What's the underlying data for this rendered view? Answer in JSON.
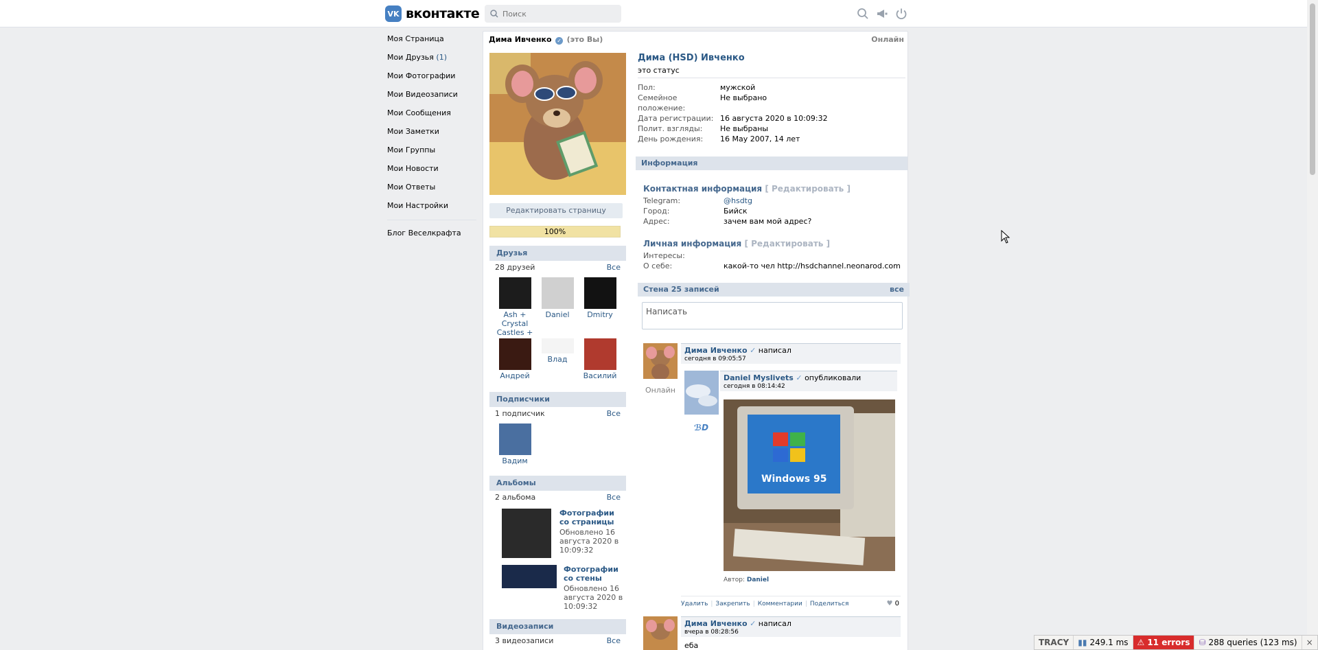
{
  "header": {
    "logo_mark": "VK",
    "logo_text": "вконтакте",
    "search_placeholder": "Поиск",
    "icons": [
      "search-icon",
      "megaphone-icon",
      "power-icon"
    ]
  },
  "leftnav": {
    "items": [
      {
        "label": "Моя Страница"
      },
      {
        "label": "Мои Друзья",
        "count": "(1)"
      },
      {
        "label": "Мои Фотографии"
      },
      {
        "label": "Мои Видеозаписи"
      },
      {
        "label": "Мои Сообщения"
      },
      {
        "label": "Мои Заметки"
      },
      {
        "label": "Мои Группы"
      },
      {
        "label": "Мои Новости"
      },
      {
        "label": "Мои Ответы"
      },
      {
        "label": "Мои Настройки"
      }
    ],
    "blog": "Блог Веселкрафта"
  },
  "page": {
    "name": "Дима Ивченко",
    "this_you": "(это Вы)",
    "online": "Онлайн",
    "edit_button": "Редактировать страницу",
    "progress": "100%",
    "progress_value": 100
  },
  "friends": {
    "title": "Друзья",
    "count": "28 друзей",
    "all": "Все",
    "items": [
      {
        "name": "Ash + Crystal Castles +"
      },
      {
        "name": "Daniel"
      },
      {
        "name": "Dmitry"
      },
      {
        "name": "Андрей"
      },
      {
        "name": "Влад"
      },
      {
        "name": "Василий"
      }
    ]
  },
  "subscribers": {
    "title": "Подписчики",
    "count": "1 подписчик",
    "all": "Все",
    "items": [
      {
        "name": "Вадим"
      }
    ]
  },
  "albums": {
    "title": "Альбомы",
    "count": "2 альбома",
    "all": "Все",
    "items": [
      {
        "title": "Фотографии со страницы",
        "updated": "Обновлено 16 августа 2020 в 10:09:32"
      },
      {
        "title": "Фотографии со стены",
        "updated": "Обновлено 16 августа 2020 в 10:09:32"
      }
    ]
  },
  "videos": {
    "title": "Видеозаписи",
    "count": "3 видеозаписи",
    "all": "Все"
  },
  "profile": {
    "full_name": "Дима (HSD) Ивченко",
    "status": "это статус",
    "rows": [
      {
        "k": "Пол:",
        "v": "мужской"
      },
      {
        "k": "Семейное положение:",
        "v": "Не выбрано"
      },
      {
        "k": "Дата регистрации:",
        "v": "16 августа 2020 в 10:09:32"
      },
      {
        "k": "Полит. взгляды:",
        "v": "Не выбраны"
      },
      {
        "k": "День рождения:",
        "v": "16 May 2007, 14 лет"
      }
    ],
    "info_title": "Информация",
    "contact_title": "Контактная информация",
    "edit_label": "[ Редактировать ]",
    "contact_rows": [
      {
        "k": "Telegram:",
        "v": "@hsdtg"
      },
      {
        "k": "Город:",
        "v": "Бийск"
      },
      {
        "k": "Адрес:",
        "v": "зачем вам мой адрес?"
      }
    ],
    "personal_title": "Личная информация",
    "personal_rows": [
      {
        "k": "Интересы:",
        "v": ""
      },
      {
        "k": "О себе:",
        "v": "какой-то чел http://hsdchannel.neonarod.com"
      }
    ]
  },
  "wall": {
    "title": "Стена 25 записей",
    "all": "все",
    "input_placeholder": "Написать",
    "posts": [
      {
        "author": "Дима Ивченко",
        "action": "написал",
        "date": "сегодня в 09:05:57",
        "online": "Онлайн",
        "repost": {
          "author": "Daniel Myslivets",
          "action": "опубликовали",
          "date": "сегодня в 08:14:42",
          "image_label": "Windows 95",
          "photo_author_label": "Автор:",
          "photo_author": "Daniel"
        },
        "actions": [
          "Удалить",
          "Закрепить",
          "Комментарии",
          "Поделиться"
        ],
        "likes": "0"
      },
      {
        "author": "Дима Ивченко",
        "action": "написал",
        "date": "вчера в 08:28:56",
        "text": "еба"
      }
    ]
  },
  "tracy": {
    "logo": "TRACY",
    "time": "249.1 ms",
    "errors": "11 errors",
    "queries": "288 queries (123 ms)",
    "close": "×"
  }
}
